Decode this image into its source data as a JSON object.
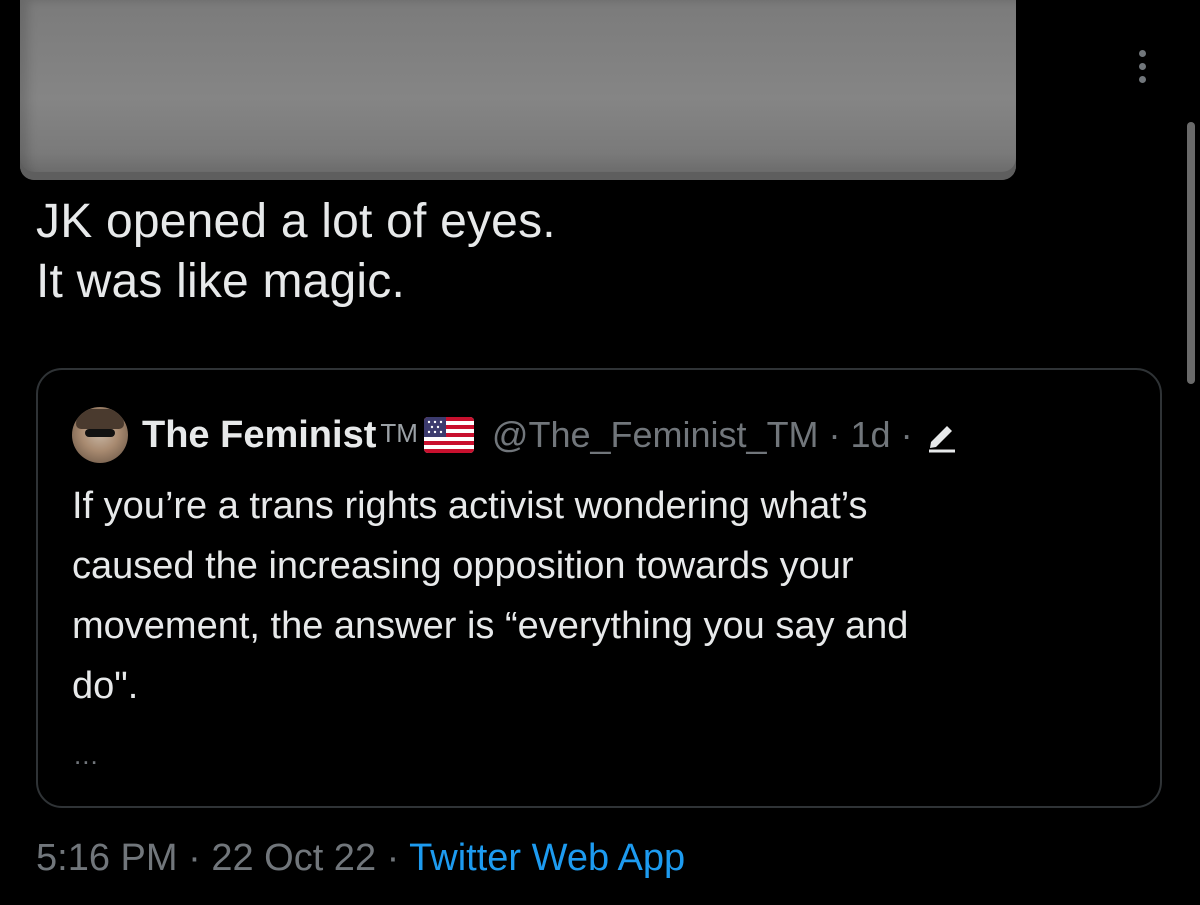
{
  "tweet": {
    "text_lines": [
      "JK opened a lot of eyes.",
      "It was like magic."
    ],
    "timestamp": "5:16 PM",
    "date": "22 Oct 22",
    "separator": "·",
    "source": "Twitter Web App",
    "more_icon": "more-vertical-icon"
  },
  "quote": {
    "display_name": "The Feminist",
    "name_suffix": "TM",
    "flag_icon": "us-flag-icon",
    "handle": "@The_Feminist_TM",
    "age": "1d",
    "edit_icon": "pencil-icon",
    "header_meta": "@The_Feminist_TM · 1d ·",
    "body_lines": [
      "If you’re a trans rights activist wondering what’s",
      "caused the increasing opposition towards your",
      "movement, the answer is “everything you say and",
      "do\"."
    ],
    "truncation": "..."
  },
  "colors": {
    "background": "#000000",
    "text_primary": "#e7e9ea",
    "text_secondary": "#71767b",
    "link": "#1d9bf0",
    "border": "#2f3336"
  }
}
